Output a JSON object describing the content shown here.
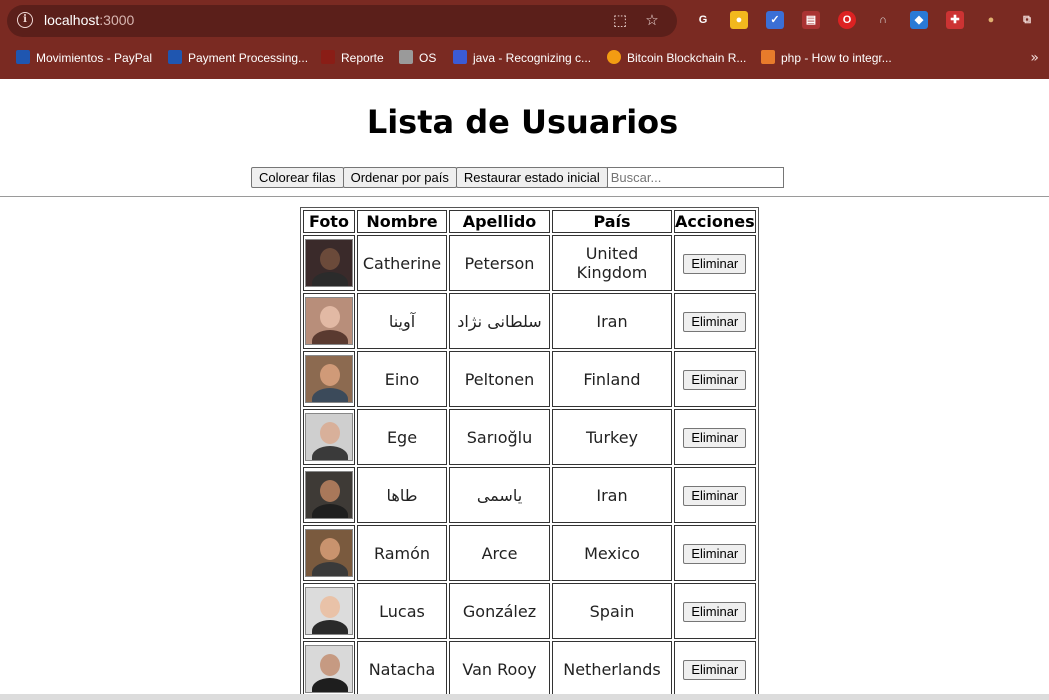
{
  "browser": {
    "url_host": "localhost",
    "url_port": ":3000",
    "bookmarks": [
      {
        "label": "Movimientos - PayPal",
        "color": "#1f56b0"
      },
      {
        "label": "Payment Processing...",
        "color": "#1f56b0"
      },
      {
        "label": "Reporte",
        "color": "#8a1d16"
      },
      {
        "label": "OS",
        "color": "#9a9a9a"
      },
      {
        "label": "java - Recognizing c...",
        "color": "#3a5bd6"
      },
      {
        "label": "Bitcoin Blockchain R...",
        "color": "#f39c12"
      },
      {
        "label": "php - How to integr...",
        "color": "#e87b2b"
      }
    ]
  },
  "page": {
    "title": "Lista de Usuarios",
    "buttons": {
      "color_rows": "Colorear filas",
      "sort_country": "Ordenar por país",
      "restore": "Restaurar estado inicial"
    },
    "search_placeholder": "Buscar..."
  },
  "table": {
    "headers": [
      "Foto",
      "Nombre",
      "Apellido",
      "País",
      "Acciones"
    ],
    "delete_label": "Eliminar",
    "rows": [
      {
        "first": "Catherine",
        "last": "Peterson",
        "country": "United Kingdom",
        "skin": "#6b4a3a",
        "bg": "#3a2a2a",
        "shirt": "#2b2b2b"
      },
      {
        "first": "آوینا",
        "last": "سلطانی نژاد",
        "country": "Iran",
        "skin": "#e2b9a4",
        "bg": "#b88e7a",
        "shirt": "#5a3a30"
      },
      {
        "first": "Eino",
        "last": "Peltonen",
        "country": "Finland",
        "skin": "#d09a78",
        "bg": "#8c6a50",
        "shirt": "#3b4a5a"
      },
      {
        "first": "Ege",
        "last": "Sarıoğlu",
        "country": "Turkey",
        "skin": "#d8b09a",
        "bg": "#cfcfcf",
        "shirt": "#3a3a3a"
      },
      {
        "first": "طاها",
        "last": "یاسمی",
        "country": "Iran",
        "skin": "#a9785a",
        "bg": "#3e3a36",
        "shirt": "#1f1f1f"
      },
      {
        "first": "Ramón",
        "last": "Arce",
        "country": "Mexico",
        "skin": "#c9936e",
        "bg": "#7a5a3e",
        "shirt": "#3a3a3a"
      },
      {
        "first": "Lucas",
        "last": "González",
        "country": "Spain",
        "skin": "#e9c2a8",
        "bg": "#dcdcdc",
        "shirt": "#2a2a2a"
      },
      {
        "first": "Natacha",
        "last": "Van Rooy",
        "country": "Netherlands",
        "skin": "#c69a82",
        "bg": "#d9d9d9",
        "shirt": "#1e1e1e"
      }
    ]
  }
}
